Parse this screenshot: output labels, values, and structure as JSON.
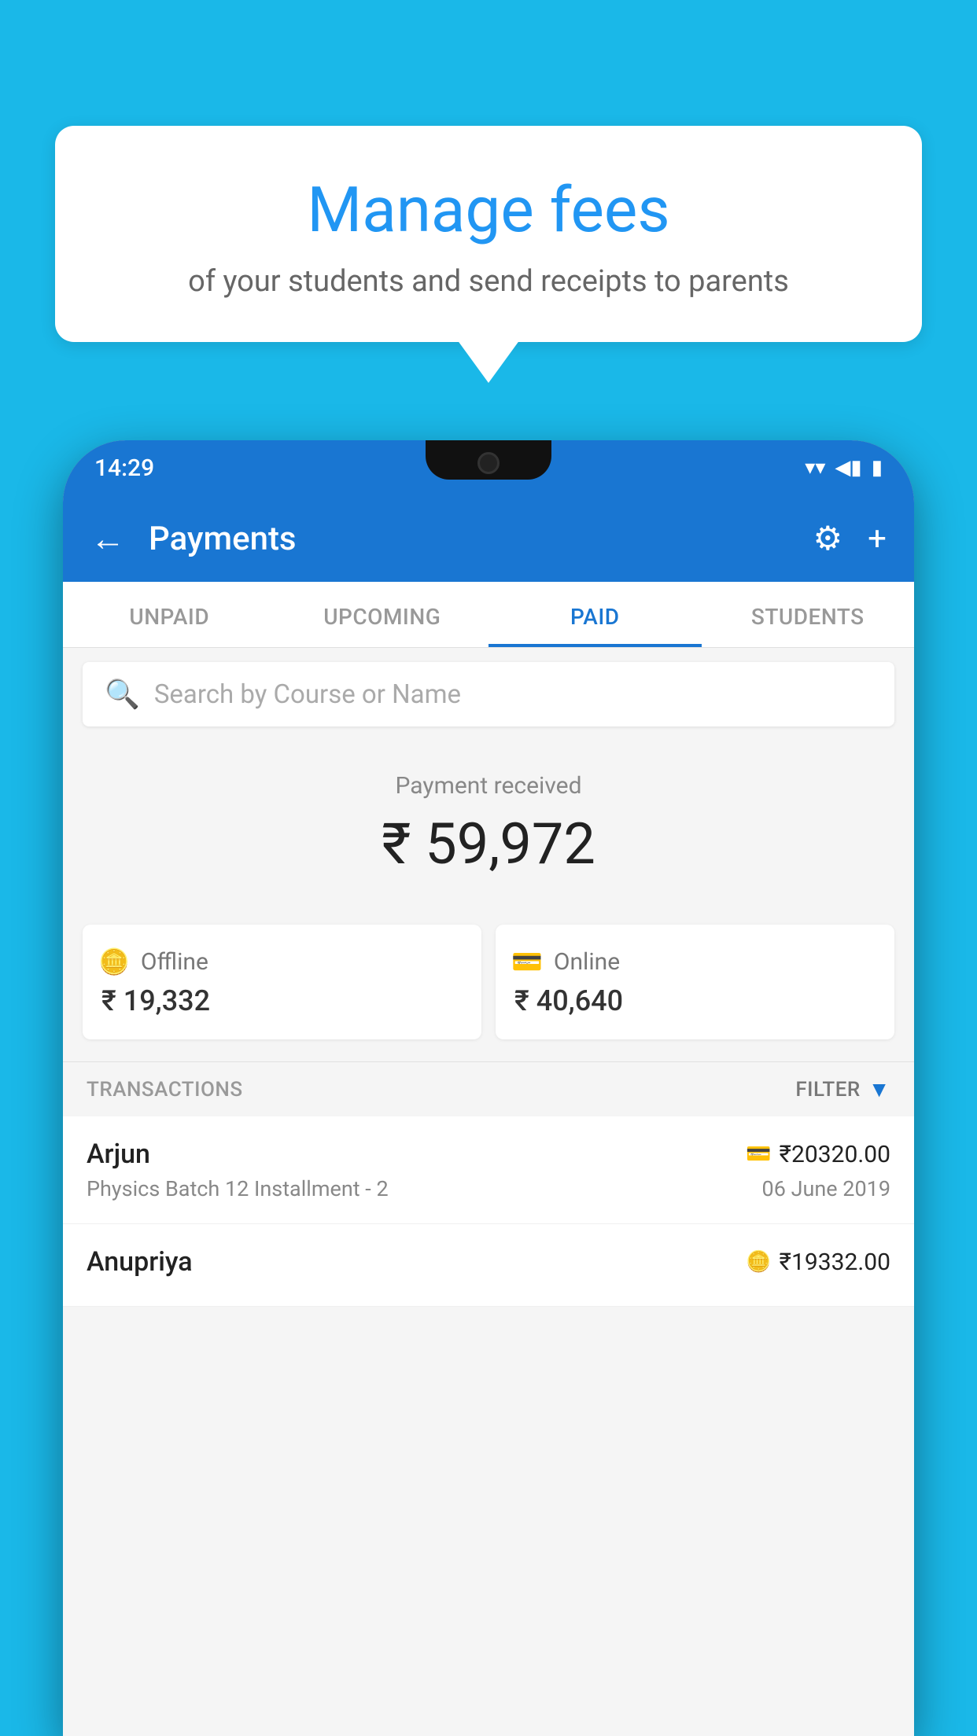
{
  "background_color": "#1ab8e8",
  "bubble": {
    "title": "Manage fees",
    "subtitle": "of your students and send receipts to parents"
  },
  "status_bar": {
    "time": "14:29",
    "signal_icon": "▲",
    "wifi_icon": "▼",
    "battery_icon": "▮"
  },
  "header": {
    "title": "Payments",
    "back_label": "←",
    "settings_label": "⚙",
    "add_label": "+"
  },
  "tabs": [
    {
      "label": "UNPAID",
      "active": false
    },
    {
      "label": "UPCOMING",
      "active": false
    },
    {
      "label": "PAID",
      "active": true
    },
    {
      "label": "STUDENTS",
      "active": false
    }
  ],
  "search": {
    "placeholder": "Search by Course or Name"
  },
  "payment_summary": {
    "label": "Payment received",
    "amount": "₹ 59,972",
    "offline_label": "Offline",
    "offline_amount": "₹ 19,332",
    "online_label": "Online",
    "online_amount": "₹ 40,640"
  },
  "transactions": {
    "header": "TRANSACTIONS",
    "filter_label": "FILTER",
    "items": [
      {
        "name": "Arjun",
        "amount": "₹20320.00",
        "description": "Physics Batch 12 Installment - 2",
        "date": "06 June 2019",
        "payment_type": "card"
      },
      {
        "name": "Anupriya",
        "amount": "₹19332.00",
        "description": "",
        "date": "",
        "payment_type": "cash"
      }
    ]
  }
}
